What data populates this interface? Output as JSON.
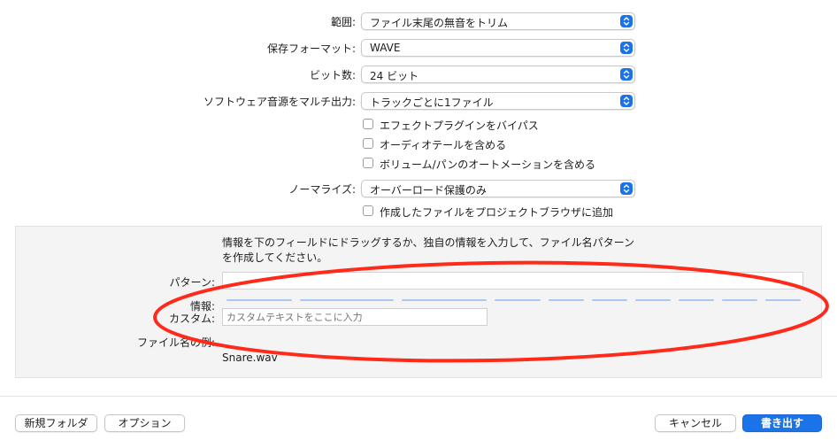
{
  "settings": {
    "range": {
      "label": "範囲:",
      "value": "ファイル末尾の無音をトリム"
    },
    "format": {
      "label": "保存フォーマット:",
      "value": "WAVE"
    },
    "bit_depth": {
      "label": "ビット数:",
      "value": "24 ビット"
    },
    "multi_output": {
      "label": "ソフトウェア音源をマルチ出力:",
      "value": "トラックごとに1ファイル"
    },
    "bypass_effects": {
      "label": "エフェクトプラグインをバイパス",
      "checked": false
    },
    "audio_tail": {
      "label": "オーディオテールを含める",
      "checked": false
    },
    "volume_pan": {
      "label": "ボリューム/パンのオートメーションを含める",
      "checked": false
    },
    "normalize": {
      "label": "ノーマライズ:",
      "value": "オーバーロード保護のみ"
    },
    "add_to_browser": {
      "label": "作成したファイルをプロジェクトブラウザに追加",
      "checked": false
    }
  },
  "naming": {
    "description_line1": "情報を下のフィールドにドラッグするか、独自の情報を入力して、ファイル名パターン",
    "description_line2": "を作成してください。",
    "pattern_label": "パターン:",
    "pattern_value": "",
    "info_label": "情報:",
    "custom_label": "カスタム:",
    "custom_placeholder": "カスタムテキストをここに入力",
    "example_label": "ファイル名の例:",
    "example_value": "Snare.wav"
  },
  "buttons": {
    "new_folder": "新規フォルダ",
    "options": "オプション",
    "cancel": "キャンセル",
    "export": "書き出す"
  },
  "colors": {
    "accent": "#1a73e8",
    "annotation_ellipse": "#ff2a1a"
  }
}
